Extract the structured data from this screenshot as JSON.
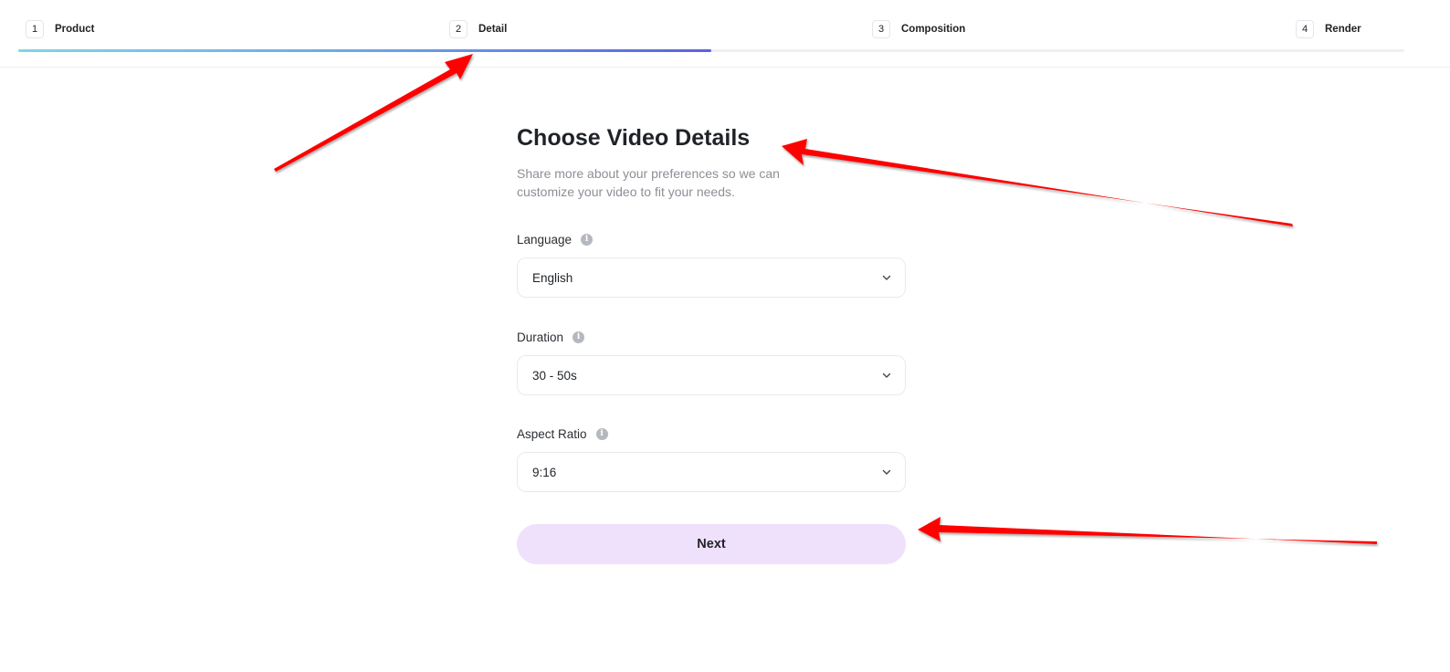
{
  "stepper": {
    "steps": [
      {
        "number": "1",
        "label": "Product"
      },
      {
        "number": "2",
        "label": "Detail"
      },
      {
        "number": "3",
        "label": "Composition"
      },
      {
        "number": "4",
        "label": "Render"
      }
    ],
    "current_step": 2,
    "progress_fraction": 0.5,
    "progress_gradient": [
      "#7fd6e6",
      "#6aa6e8",
      "#5b62dc"
    ]
  },
  "main": {
    "title": "Choose Video Details",
    "subtitle": "Share more about your preferences so we can customize your video to fit your needs.",
    "fields": {
      "language": {
        "label": "Language",
        "value": "English"
      },
      "duration": {
        "label": "Duration",
        "value": "30 - 50s"
      },
      "aspect_ratio": {
        "label": "Aspect Ratio",
        "value": "9:16"
      }
    },
    "next_label": "Next",
    "next_button_color": "#efe1fb"
  },
  "annotations": {
    "arrow_color": "#ff0000",
    "icons": [
      "annotation-arrow-icon",
      "info-icon",
      "chevron-down-icon"
    ]
  }
}
